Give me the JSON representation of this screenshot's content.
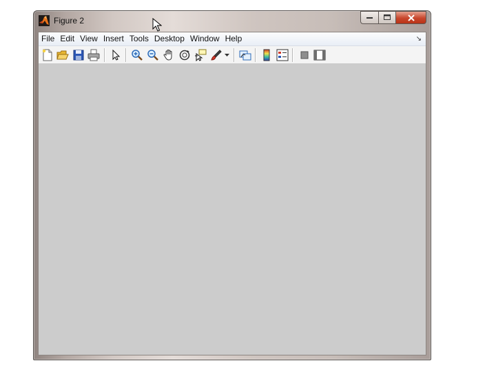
{
  "window": {
    "title": "Figure 2",
    "controls": {
      "minimize": "minimize-button",
      "maximize": "maximize-button",
      "close": "close-button"
    }
  },
  "menubar": {
    "items": [
      "File",
      "Edit",
      "View",
      "Insert",
      "Tools",
      "Desktop",
      "Window",
      "Help"
    ],
    "dock_arrow": "↘"
  },
  "toolbar": {
    "buttons": [
      {
        "icon": "new-figure-icon"
      },
      {
        "icon": "open-file-icon"
      },
      {
        "icon": "save-figure-icon"
      },
      {
        "icon": "print-figure-icon"
      },
      {
        "icon": "edit-plot-arrow-icon"
      },
      {
        "icon": "zoom-in-icon"
      },
      {
        "icon": "zoom-out-icon"
      },
      {
        "icon": "pan-hand-icon"
      },
      {
        "icon": "rotate-3d-icon"
      },
      {
        "icon": "data-cursor-icon"
      },
      {
        "icon": "brush-icon"
      },
      {
        "icon": "link-plot-icon"
      },
      {
        "icon": "insert-colorbar-icon"
      },
      {
        "icon": "insert-legend-icon"
      },
      {
        "icon": "hide-plot-tools-icon"
      },
      {
        "icon": "show-plot-tools-icon"
      }
    ]
  },
  "colors": {
    "canvas_background": "#cccccc",
    "close_button": "#c8462c"
  }
}
